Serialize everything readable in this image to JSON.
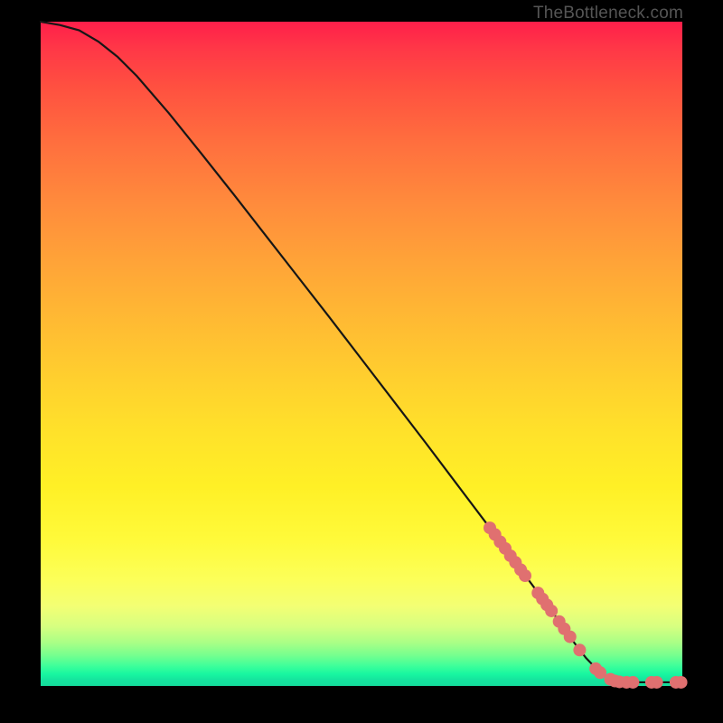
{
  "watermark": "TheBottleneck.com",
  "chart_data": {
    "type": "line",
    "title": "",
    "xlabel": "",
    "ylabel": "",
    "xlim": [
      0,
      100
    ],
    "ylim": [
      0,
      100
    ],
    "curve": [
      {
        "x": 0.0,
        "y": 100.0
      },
      {
        "x": 3.0,
        "y": 99.5
      },
      {
        "x": 6.0,
        "y": 98.7
      },
      {
        "x": 9.0,
        "y": 97.0
      },
      {
        "x": 12.0,
        "y": 94.7
      },
      {
        "x": 15.0,
        "y": 91.8
      },
      {
        "x": 20.0,
        "y": 86.2
      },
      {
        "x": 25.0,
        "y": 80.2
      },
      {
        "x": 30.0,
        "y": 74.1
      },
      {
        "x": 35.0,
        "y": 67.9
      },
      {
        "x": 40.0,
        "y": 61.7
      },
      {
        "x": 45.0,
        "y": 55.5
      },
      {
        "x": 50.0,
        "y": 49.2
      },
      {
        "x": 55.0,
        "y": 42.9
      },
      {
        "x": 60.0,
        "y": 36.6
      },
      {
        "x": 65.0,
        "y": 30.2
      },
      {
        "x": 70.0,
        "y": 23.8
      },
      {
        "x": 75.0,
        "y": 17.3
      },
      {
        "x": 80.0,
        "y": 10.8
      },
      {
        "x": 83.0,
        "y": 6.7
      },
      {
        "x": 85.0,
        "y": 4.2
      },
      {
        "x": 87.0,
        "y": 2.2
      },
      {
        "x": 88.5,
        "y": 1.2
      },
      {
        "x": 90.0,
        "y": 0.7
      },
      {
        "x": 92.0,
        "y": 0.55
      },
      {
        "x": 95.0,
        "y": 0.55
      },
      {
        "x": 100.0,
        "y": 0.55
      }
    ],
    "points": [
      {
        "x": 70.0,
        "y": 23.8
      },
      {
        "x": 70.8,
        "y": 22.8
      },
      {
        "x": 71.6,
        "y": 21.7
      },
      {
        "x": 72.4,
        "y": 20.7
      },
      {
        "x": 73.2,
        "y": 19.6
      },
      {
        "x": 74.0,
        "y": 18.6
      },
      {
        "x": 74.8,
        "y": 17.5
      },
      {
        "x": 75.5,
        "y": 16.6
      },
      {
        "x": 77.5,
        "y": 14.0
      },
      {
        "x": 78.2,
        "y": 13.1
      },
      {
        "x": 78.9,
        "y": 12.2
      },
      {
        "x": 79.6,
        "y": 11.3
      },
      {
        "x": 80.8,
        "y": 9.7
      },
      {
        "x": 81.6,
        "y": 8.6
      },
      {
        "x": 82.5,
        "y": 7.4
      },
      {
        "x": 84.0,
        "y": 5.4
      },
      {
        "x": 86.5,
        "y": 2.6
      },
      {
        "x": 87.2,
        "y": 2.0
      },
      {
        "x": 88.8,
        "y": 1.0
      },
      {
        "x": 89.5,
        "y": 0.75
      },
      {
        "x": 90.2,
        "y": 0.62
      },
      {
        "x": 91.3,
        "y": 0.55
      },
      {
        "x": 92.3,
        "y": 0.55
      },
      {
        "x": 95.2,
        "y": 0.55
      },
      {
        "x": 96.0,
        "y": 0.55
      },
      {
        "x": 99.0,
        "y": 0.55
      },
      {
        "x": 99.8,
        "y": 0.55
      }
    ],
    "colors": {
      "curve": "#161616",
      "point": "#e07070",
      "background_top": "#ff1f4a",
      "background_bottom": "#14dd9c"
    }
  }
}
